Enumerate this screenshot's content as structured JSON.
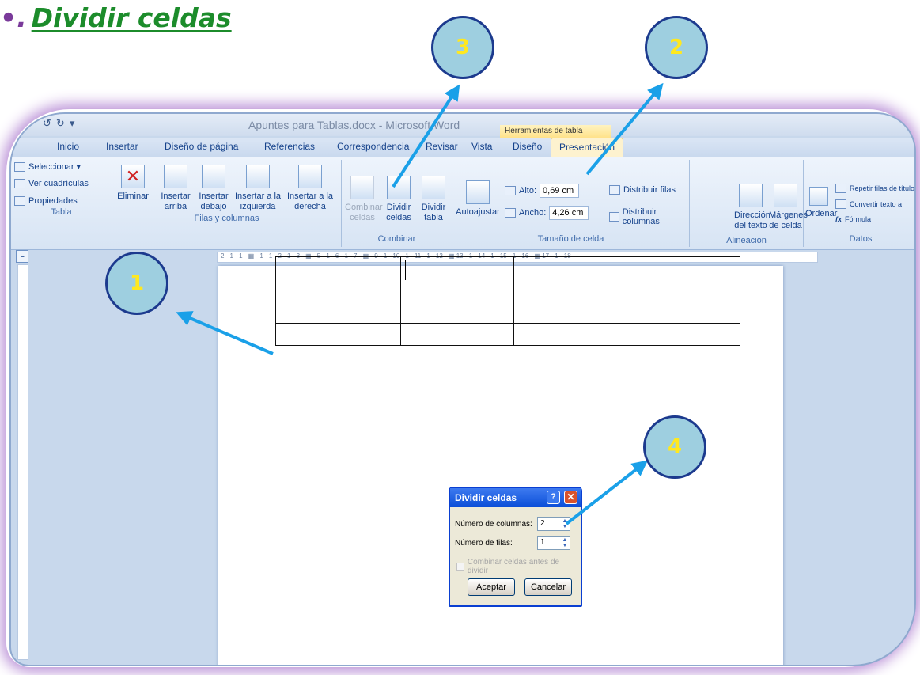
{
  "slide": {
    "bullet": "•.",
    "title": "Dividir celdas"
  },
  "window": {
    "title": "Apuntes para Tablas.docx - Microsoft Word",
    "tools_band": "Herramientas de tabla",
    "qat": [
      "↺",
      "↻",
      "▾"
    ]
  },
  "tabs": [
    "Inicio",
    "Insertar",
    "Diseño de página",
    "Referencias",
    "Correspondencia",
    "Revisar",
    "Vista",
    "Diseño",
    "Presentación"
  ],
  "ribbon": {
    "tabla": {
      "items": [
        "Seleccionar ▾",
        "Ver cuadrículas",
        "Propiedades"
      ],
      "label": "Tabla"
    },
    "filas_columnas": {
      "eliminar": "Eliminar",
      "insert_above": "Insertar arriba",
      "insert_below": "Insertar debajo",
      "insert_left": "Insertar a la izquierda",
      "insert_right": "Insertar a la derecha",
      "label": "Filas y columnas"
    },
    "combinar": {
      "merge": "Combinar celdas",
      "split_cells": "Dividir celdas",
      "split_table": "Dividir tabla",
      "label": "Combinar"
    },
    "tamano": {
      "autofit": "Autoajustar",
      "alto_label": "Alto:",
      "alto_value": "0,69 cm",
      "ancho_label": "Ancho:",
      "ancho_value": "4,26 cm",
      "dist_rows": "Distribuir filas",
      "dist_cols": "Distribuir columnas",
      "label": "Tamaño de celda"
    },
    "alineacion": {
      "direction": "Dirección del texto",
      "margins": "Márgenes de celda",
      "label": "Alineación"
    },
    "datos": {
      "sort": "Ordenar",
      "repeat": "Repetir filas de título",
      "convert": "Convertir texto a",
      "formula": "Fórmula",
      "label": "Datos"
    }
  },
  "ruler": {
    "marks": "2 · 1 · 1 · ▦ · 1 · 1 · 2 · 1 · 3 · ▦ · 5 · 1 · 6 · 1 · 7 · ▦ · 9 · 1 · 10 · 1 · 11 · 1 · 12 · ▦ 13 · 1 · 14 · 1 · 15 · 1 · 16 · ▦ 17 · 1 · 18"
  },
  "dialog": {
    "title": "Dividir celdas",
    "cols_label": "Número de columnas:",
    "cols_value": "2",
    "rows_label": "Número de filas:",
    "rows_value": "1",
    "merge_check": "Combinar celdas antes de dividir",
    "ok": "Aceptar",
    "cancel": "Cancelar"
  },
  "callouts": [
    "1",
    "2",
    "3",
    "4"
  ],
  "colors": {
    "title_green": "#1c8c2b",
    "callout_fill": "#9ecfe0",
    "callout_text": "#ffe81f",
    "arrow": "#1aa0e8"
  }
}
